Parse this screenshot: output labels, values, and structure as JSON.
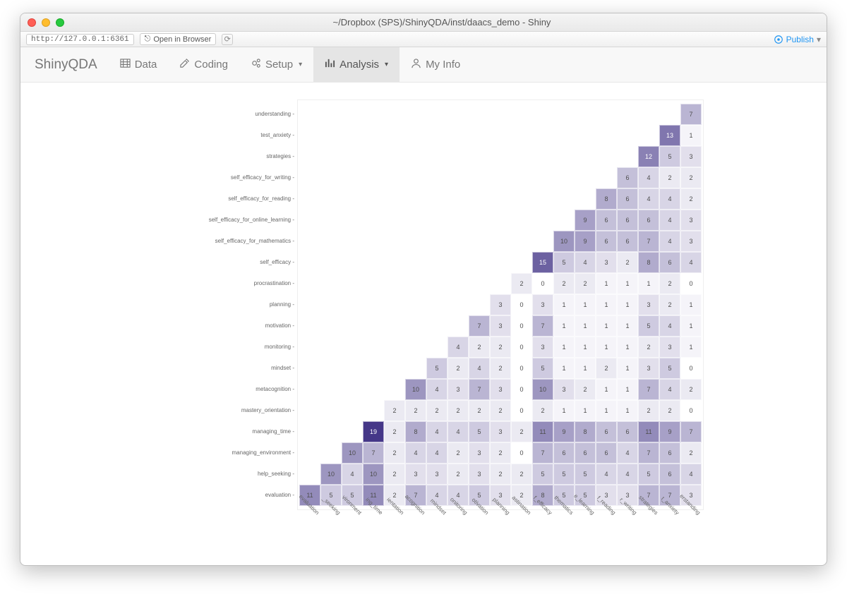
{
  "window": {
    "title": "~/Dropbox (SPS)/ShinyQDA/inst/daacs_demo - Shiny",
    "address": "http://127.0.0.1:6361",
    "open_browser": "Open in Browser",
    "publish": "Publish"
  },
  "nav": {
    "brand": "ShinyQDA",
    "data": "Data",
    "coding": "Coding",
    "setup": "Setup",
    "analysis": "Analysis",
    "myinfo": "My Info"
  },
  "chart_data": {
    "type": "heatmap",
    "categories": [
      "evaluation",
      "help_seeking",
      "managing_environment",
      "managing_time",
      "mastery_orientation",
      "metacognition",
      "mindset",
      "monitoring",
      "motivation",
      "planning",
      "procrastination",
      "self_efficacy",
      "self_efficacy_for_mathematics",
      "self_efficacy_for_online_learning",
      "self_efficacy_for_reading",
      "self_efficacy_for_writing",
      "strategies",
      "test_anxiety",
      "understanding"
    ],
    "y_order": [
      "understanding",
      "test_anxiety",
      "strategies",
      "self_efficacy_for_writing",
      "self_efficacy_for_reading",
      "self_efficacy_for_online_learning",
      "self_efficacy_for_mathematics",
      "self_efficacy",
      "procrastination",
      "planning",
      "motivation",
      "monitoring",
      "mindset",
      "metacognition",
      "mastery_orientation",
      "managing_time",
      "managing_environment",
      "help_seeking",
      "evaluation"
    ],
    "matrix": {
      "understanding": {
        "understanding": 7
      },
      "test_anxiety": {
        "test_anxiety": 13,
        "understanding": 1
      },
      "strategies": {
        "strategies": 12,
        "test_anxiety": 5,
        "understanding": 3
      },
      "self_efficacy_for_writing": {
        "self_efficacy_for_writing": 6,
        "strategies": 4,
        "test_anxiety": 2,
        "understanding": 2
      },
      "self_efficacy_for_reading": {
        "self_efficacy_for_reading": 8,
        "self_efficacy_for_writing": 6,
        "strategies": 4,
        "test_anxiety": 4,
        "understanding": 2
      },
      "self_efficacy_for_online_learning": {
        "self_efficacy_for_online_learning": 9,
        "self_efficacy_for_reading": 6,
        "self_efficacy_for_writing": 6,
        "strategies": 6,
        "test_anxiety": 4,
        "understanding": 3
      },
      "self_efficacy_for_mathematics": {
        "self_efficacy_for_mathematics": 10,
        "self_efficacy_for_online_learning": 9,
        "self_efficacy_for_reading": 6,
        "self_efficacy_for_writing": 6,
        "strategies": 7,
        "test_anxiety": 4,
        "understanding": 3
      },
      "self_efficacy": {
        "self_efficacy": 15,
        "self_efficacy_for_mathematics": 5,
        "self_efficacy_for_online_learning": 4,
        "self_efficacy_for_reading": 3,
        "self_efficacy_for_writing": 2,
        "strategies": 8,
        "test_anxiety": 6,
        "understanding": 4
      },
      "procrastination": {
        "procrastination": 2,
        "self_efficacy": 0,
        "self_efficacy_for_mathematics": 2,
        "self_efficacy_for_online_learning": 2,
        "self_efficacy_for_reading": 1,
        "self_efficacy_for_writing": 1,
        "strategies": 1,
        "test_anxiety": 2,
        "understanding": 0
      },
      "planning": {
        "planning": 3,
        "procrastination": 0,
        "self_efficacy": 3,
        "self_efficacy_for_mathematics": 1,
        "self_efficacy_for_online_learning": 1,
        "self_efficacy_for_reading": 1,
        "self_efficacy_for_writing": 1,
        "strategies": 3,
        "test_anxiety": 2,
        "understanding": 1
      },
      "motivation": {
        "motivation": 7,
        "planning": 3,
        "procrastination": 0,
        "self_efficacy": 7,
        "self_efficacy_for_mathematics": 1,
        "self_efficacy_for_online_learning": 1,
        "self_efficacy_for_reading": 1,
        "self_efficacy_for_writing": 1,
        "strategies": 5,
        "test_anxiety": 4,
        "understanding": 1
      },
      "monitoring": {
        "monitoring": 4,
        "motivation": 2,
        "planning": 2,
        "procrastination": 0,
        "self_efficacy": 3,
        "self_efficacy_for_mathematics": 1,
        "self_efficacy_for_online_learning": 1,
        "self_efficacy_for_reading": 1,
        "self_efficacy_for_writing": 1,
        "strategies": 2,
        "test_anxiety": 3,
        "understanding": 1
      },
      "mindset": {
        "mindset": 5,
        "monitoring": 2,
        "motivation": 4,
        "planning": 2,
        "procrastination": 0,
        "self_efficacy": 5,
        "self_efficacy_for_mathematics": 1,
        "self_efficacy_for_online_learning": 1,
        "self_efficacy_for_reading": 2,
        "self_efficacy_for_writing": 1,
        "strategies": 3,
        "test_anxiety": 5,
        "understanding": 0
      },
      "metacognition": {
        "metacognition": 10,
        "mindset": 4,
        "monitoring": 3,
        "motivation": 7,
        "planning": 3,
        "procrastination": 0,
        "self_efficacy": 10,
        "self_efficacy_for_mathematics": 3,
        "self_efficacy_for_online_learning": 2,
        "self_efficacy_for_reading": 1,
        "self_efficacy_for_writing": 1,
        "strategies": 7,
        "test_anxiety": 4,
        "understanding": 2
      },
      "mastery_orientation": {
        "mastery_orientation": 2,
        "metacognition": 2,
        "mindset": 2,
        "monitoring": 2,
        "motivation": 2,
        "planning": 2,
        "procrastination": 0,
        "self_efficacy": 2,
        "self_efficacy_for_mathematics": 1,
        "self_efficacy_for_online_learning": 1,
        "self_efficacy_for_reading": 1,
        "self_efficacy_for_writing": 1,
        "strategies": 2,
        "test_anxiety": 2,
        "understanding": 0
      },
      "managing_time": {
        "managing_time": 19,
        "mastery_orientation": 2,
        "metacognition": 8,
        "mindset": 4,
        "monitoring": 4,
        "motivation": 5,
        "planning": 3,
        "procrastination": 2,
        "self_efficacy": 11,
        "self_efficacy_for_mathematics": 9,
        "self_efficacy_for_online_learning": 8,
        "self_efficacy_for_reading": 6,
        "self_efficacy_for_writing": 6,
        "strategies": 11,
        "test_anxiety": 9,
        "understanding": 7
      },
      "managing_environment": {
        "managing_environment": 10,
        "managing_time": 7,
        "mastery_orientation": 2,
        "metacognition": 4,
        "mindset": 4,
        "monitoring": 2,
        "motivation": 3,
        "planning": 2,
        "procrastination": 0,
        "self_efficacy": 7,
        "self_efficacy_for_mathematics": 6,
        "self_efficacy_for_online_learning": 6,
        "self_efficacy_for_reading": 6,
        "self_efficacy_for_writing": 4,
        "strategies": 7,
        "test_anxiety": 6,
        "understanding": 2
      },
      "help_seeking": {
        "help_seeking": 10,
        "managing_environment": 4,
        "managing_time": 10,
        "mastery_orientation": 2,
        "metacognition": 3,
        "mindset": 3,
        "monitoring": 2,
        "motivation": 3,
        "planning": 2,
        "procrastination": 2,
        "self_efficacy": 5,
        "self_efficacy_for_mathematics": 5,
        "self_efficacy_for_online_learning": 5,
        "self_efficacy_for_reading": 4,
        "self_efficacy_for_writing": 4,
        "strategies": 5,
        "test_anxiety": 6,
        "understanding": 4
      },
      "evaluation": {
        "evaluation": 11,
        "help_seeking": 5,
        "managing_environment": 5,
        "managing_time": 11,
        "mastery_orientation": 2,
        "metacognition": 7,
        "mindset": 4,
        "monitoring": 4,
        "motivation": 5,
        "planning": 3,
        "procrastination": 2,
        "self_efficacy": 8,
        "self_efficacy_for_mathematics": 5,
        "self_efficacy_for_online_learning": 5,
        "self_efficacy_for_reading": 3,
        "self_efficacy_for_writing": 3,
        "strategies": 7,
        "test_anxiety": 7,
        "understanding": 3
      }
    },
    "x_short_labels": [
      "evaluation",
      "_seeking",
      "vironment",
      "ing_time",
      "ientation",
      "acognition",
      "mindset",
      "onitoring",
      "otivation",
      "planning",
      "astination",
      "f_efficacy",
      "thematics",
      "e_learning",
      "f_reading",
      "r_writing",
      "strategies",
      "t_anxiety",
      "erstanding"
    ],
    "color_max": "#453788",
    "color_min": "#ffffff"
  }
}
